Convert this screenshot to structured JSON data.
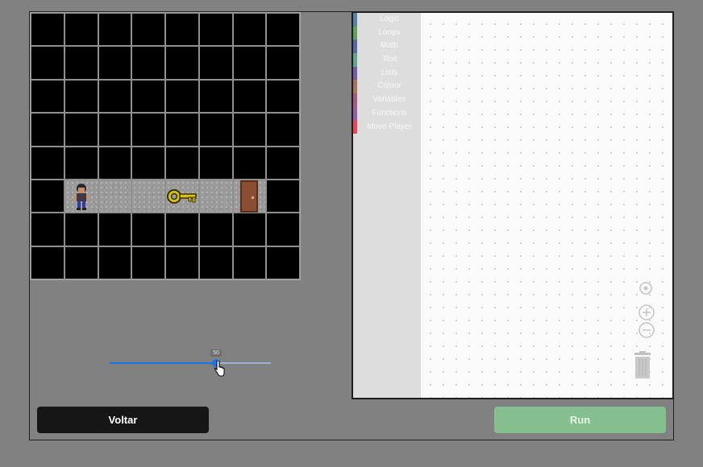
{
  "game": {
    "grid_rows": 8,
    "grid_cols": 8,
    "corridor_row": 5,
    "player": {
      "row": 5,
      "col": 1,
      "icon": "player-sprite-icon"
    },
    "key": {
      "row": 5,
      "col": 4,
      "icon": "key-icon"
    },
    "door": {
      "row": 5,
      "col": 6,
      "icon": "door-icon"
    },
    "floor_cols": [
      1,
      2,
      3,
      4,
      5,
      6,
      7
    ]
  },
  "slider": {
    "value_label": "50",
    "value_percent": 66
  },
  "buttons": {
    "voltar": "Voltar",
    "run": "Run"
  },
  "toolbox": {
    "categories": [
      {
        "label": "Logic",
        "color": "#5b80a5"
      },
      {
        "label": "Loops",
        "color": "#5ba55b"
      },
      {
        "label": "Math",
        "color": "#5b67a5"
      },
      {
        "label": "Text",
        "color": "#5ba58c"
      },
      {
        "label": "Lists",
        "color": "#745ba5"
      },
      {
        "label": "Colour",
        "color": "#a5745b"
      },
      {
        "label": "Variables",
        "color": "#a55b80"
      },
      {
        "label": "Functions",
        "color": "#995ba5"
      },
      {
        "label": "Move Player",
        "color": "#e8465a"
      }
    ]
  },
  "workspace_controls": [
    "recenter-icon",
    "zoom-in-icon",
    "zoom-out-icon",
    "trash-icon"
  ],
  "colors": {
    "run_button": "#86bf8f",
    "voltar_button": "#161616",
    "slider_accent": "#1a73e8"
  }
}
